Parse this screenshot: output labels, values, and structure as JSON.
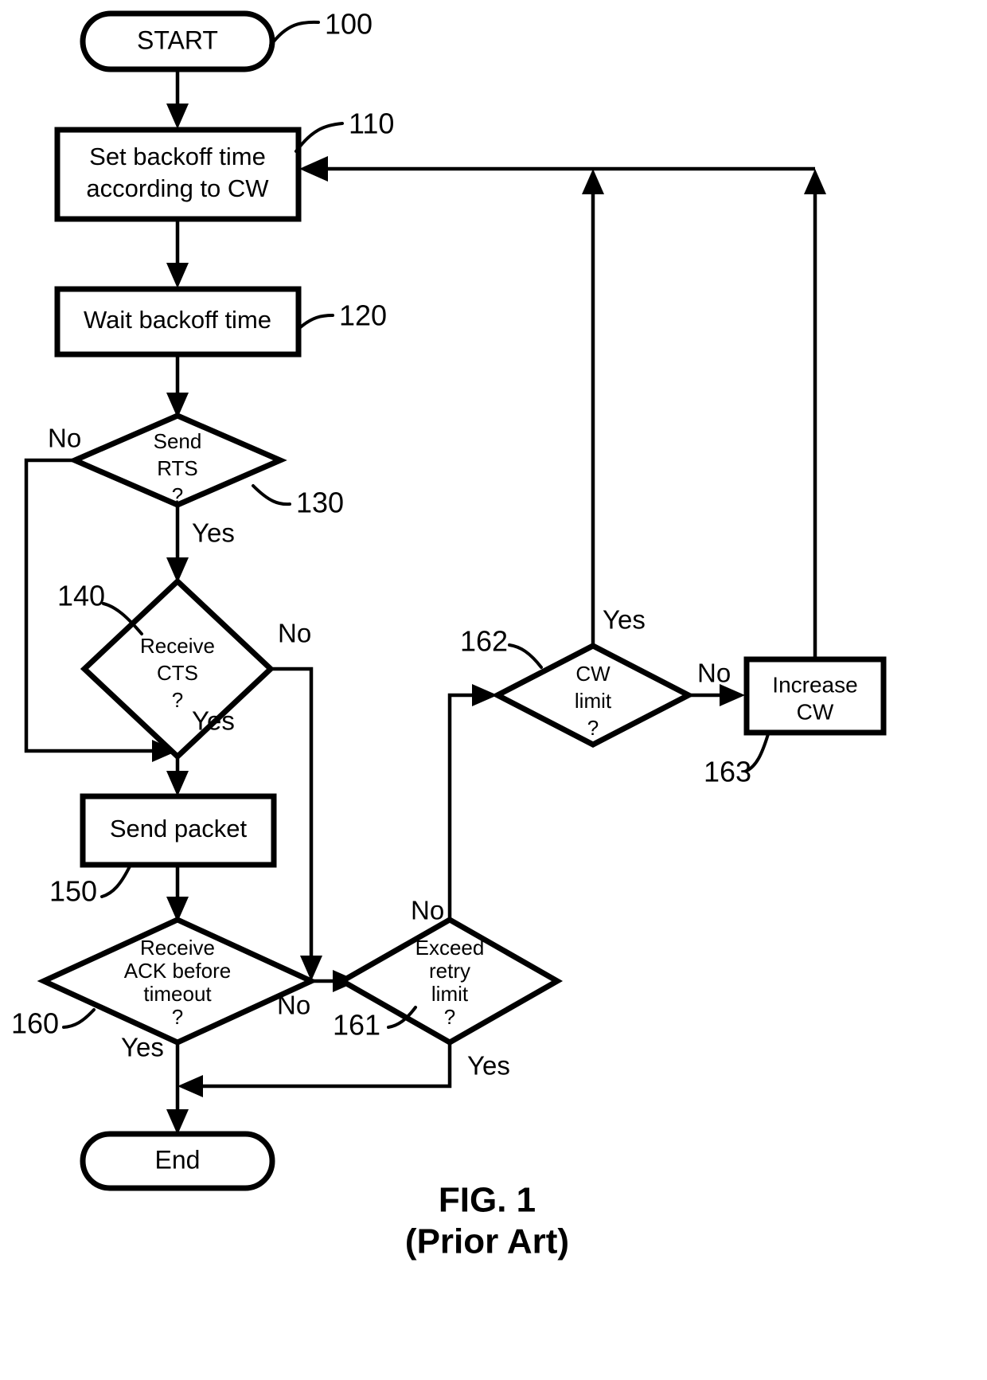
{
  "figure": {
    "caption_line1": "FIG. 1",
    "caption_line2": "(Prior Art)"
  },
  "nodes": {
    "start": {
      "label": "START",
      "ref": "100",
      "shape": "terminal"
    },
    "set_backoff": {
      "label_line1": "Set backoff time",
      "label_line2": "according to CW",
      "ref": "110",
      "shape": "process"
    },
    "wait_backoff": {
      "label": "Wait backoff time",
      "ref": "120",
      "shape": "process"
    },
    "send_rts": {
      "label_line1": "Send",
      "label_line2": "RTS",
      "label_line3": "?",
      "ref": "130",
      "shape": "decision"
    },
    "receive_cts": {
      "label_line1": "Receive",
      "label_line2": "CTS",
      "label_line3": "?",
      "ref": "140",
      "shape": "decision"
    },
    "send_packet": {
      "label": "Send packet",
      "ref": "150",
      "shape": "process"
    },
    "receive_ack": {
      "label_line1": "Receive",
      "label_line2": "ACK before",
      "label_line3": "timeout",
      "label_line4": "?",
      "ref": "160",
      "shape": "decision"
    },
    "exceed_retry": {
      "label_line1": "Exceed",
      "label_line2": "retry",
      "label_line3": "limit",
      "label_line4": "?",
      "ref": "161",
      "shape": "decision"
    },
    "cw_limit": {
      "label_line1": "CW",
      "label_line2": "limit",
      "label_line3": "?",
      "ref": "162",
      "shape": "decision"
    },
    "increase_cw": {
      "label_line1": "Increase",
      "label_line2": "CW",
      "ref": "163",
      "shape": "process"
    },
    "end": {
      "label": "End",
      "shape": "terminal"
    }
  },
  "branches": {
    "send_rts_no": "No",
    "send_rts_yes": "Yes",
    "receive_cts_no": "No",
    "receive_cts_yes": "Yes",
    "receive_ack_no": "No",
    "receive_ack_yes": "Yes",
    "exceed_retry_no": "No",
    "exceed_retry_yes": "Yes",
    "cw_limit_yes": "Yes",
    "cw_limit_no": "No"
  },
  "colors": {
    "stroke": "#000000",
    "fill": "#ffffff"
  }
}
